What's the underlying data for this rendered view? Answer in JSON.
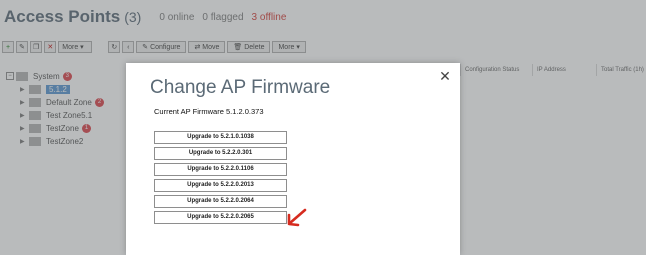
{
  "page": {
    "title": "Access Points",
    "count": "(3)",
    "online": "0 online",
    "flagged": "0 flagged",
    "offline": "3 offline"
  },
  "toolbar": {
    "more_label": "More",
    "configure_label": "Configure",
    "move_label": "Move",
    "delete_label": "Delete",
    "more2_label": "More"
  },
  "tree": {
    "root": {
      "label": "System",
      "badge": "3"
    },
    "items": [
      {
        "label": "5.1.2",
        "selected": true
      },
      {
        "label": "Default Zone",
        "badge": "2"
      },
      {
        "label": "Test Zone5.1"
      },
      {
        "label": "TestZone",
        "badge": "1"
      },
      {
        "label": "TestZone2"
      }
    ]
  },
  "grid": {
    "columns": [
      "Configuration Status",
      "IP Address",
      "Total Traffic (1h)"
    ]
  },
  "modal": {
    "title": "Change AP Firmware",
    "current_firmware_label": "Current AP Firmware",
    "current_firmware_version": "5.1.2.0.373",
    "upgrade_options": [
      "Upgrade to 5.2.1.0.1038",
      "Upgrade to 5.2.2.0.301",
      "Upgrade to 5.2.2.0.1106",
      "Upgrade to 5.2.2.0.2013",
      "Upgrade to 5.2.2.0.2064",
      "Upgrade to 5.2.2.0.2065"
    ]
  },
  "colors": {
    "arrow": "#d62b1f",
    "offline": "#d9534f",
    "badge": "#e0585f",
    "title": "#5b6a76"
  }
}
